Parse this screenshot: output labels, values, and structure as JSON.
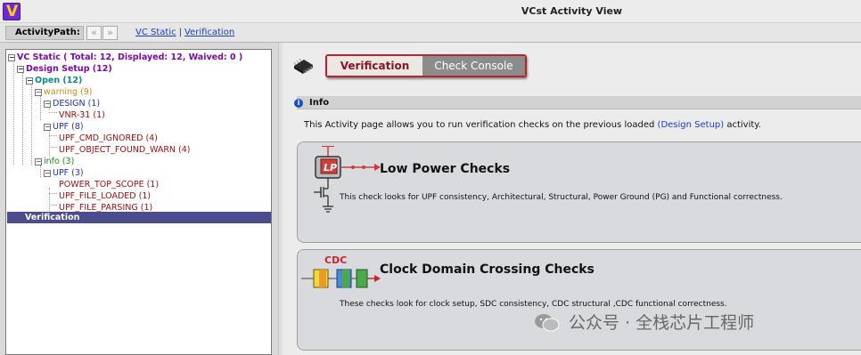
{
  "window": {
    "title": "VCst Activity View"
  },
  "pathbar": {
    "label": "ActivityPath:",
    "crumbs": [
      "VC Static",
      "Verification"
    ],
    "separator": "|"
  },
  "tree": {
    "root": "VC Static ( Total: 12, Displayed: 12, Waived: 0 )",
    "design_setup": "Design Setup (12)",
    "open": "Open (12)",
    "warning": "warning (9)",
    "design": "DESIGN (1)",
    "vnr": "VNR-31 (1)",
    "upf8": "UPF (8)",
    "upf_cmd_ignored": "UPF_CMD_IGNORED (4)",
    "upf_object_found_warn": "UPF_OBJECT_FOUND_WARN (4)",
    "info": "info (3)",
    "upf3": "UPF (3)",
    "power_top_scope": "POWER_TOP_SCOPE (1)",
    "upf_file_loaded": "UPF_FILE_LOADED (1)",
    "upf_file_parsing": "UPF_FILE_PARSING (1)",
    "verification": "Verification"
  },
  "tabs": {
    "active": "Verification",
    "inactive": "Check Console"
  },
  "info": {
    "header": "Info",
    "text_before": "This Activity page allows you to run verification checks on the previous loaded ",
    "link": "(Design Setup)",
    "text_after": " activity."
  },
  "cards": {
    "low_power": {
      "badge": "LP",
      "title": "Low Power Checks",
      "desc": "This check looks for UPF consistency, Architectural, Structural, Power Ground (PG) and Functional correctness."
    },
    "cdc": {
      "badge": "CDC",
      "title": "Clock Domain Crossing Checks",
      "desc": "These checks look for clock setup, SDC consistency, CDC structural ,CDC functional correctness."
    }
  },
  "watermark": "公众号 · 全栈芯片工程师",
  "colors": {
    "accent": "#b8242e",
    "link": "#1a3fbf",
    "selection": "#4c4c8c"
  }
}
